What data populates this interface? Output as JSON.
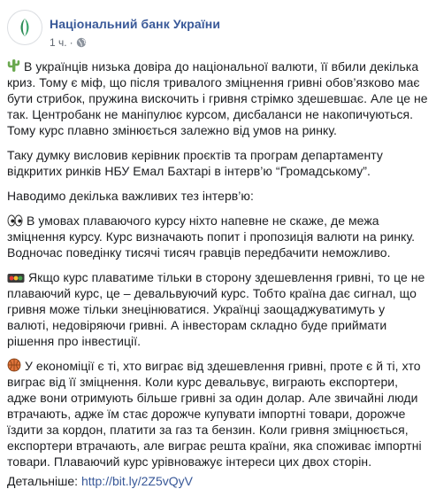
{
  "header": {
    "page_name": "Національний банк України",
    "time": "1 ч.",
    "separator": "·"
  },
  "paragraphs": [
    "В українців низька довіра до національної валюти, її вбили декілька криз. Тому є міф, що після тривалого зміцнення гривні обов’язково має бути стрибок, пружина вискочить і гривня стрімко здешевшає. Але це не так. Центробанк не маніпулює курсом, дисбаланси не накопичуються. Тому курс плавно змінюється залежно від умов на ринку.",
    "Таку думку висловив керівник проєктів та програм департаменту відкритих ринків НБУ Емал Бахтарі в інтерв’ю “Громадському”.",
    "Наводимо декілька важливих тез інтерв’ю:",
    "В умовах плаваючого курсу ніхто напевне не скаже, де межа зміцнення курсу. Курс визначають попит і пропозиція валюти на ринку. Водночас поведінку тисячі тисяч гравців передбачити неможливо.",
    "Якщо курс плаватиме тільки в сторону здешевлення гривні, то це не плаваючий курс, це – девальвуючий курс. Тобто країна дає сигнал, що гривня може тільки знецінюватися. Українці заощаджуватимуть у валюті, недовіряючи гривні. А інвесторам складно буде приймати рішення про інвестиції.",
    "У економіції є ті, хто виграє від здешевлення гривні, проте є й ті, хто виграє від її зміцнення. Коли курс девальвує, виграють експортери, адже вони отримують більше гривні за один долар. Але звичайні люди втрачають, адже їм стає дорожче купувати імпортні товари, дорожче їздити за кордон, платити за газ та бензин. Коли гривня зміцнюється, експортери втрачають, але виграє решта країни, яка споживає імпортні товари. Плаваючий курс урівноважує інтереси цих двох сторін."
  ],
  "tail": {
    "label": "Детальніше:",
    "link": "http://bit.ly/2Z5vQyV"
  },
  "icons": {
    "avatar": "nbu-logo-icon",
    "globe": "globe-icon",
    "p1": "cactus-icon",
    "p4": "eyes-icon",
    "p5": "traffic-light-icon",
    "p6": "basketball-icon"
  },
  "colors": {
    "link": "#385898",
    "text": "#1c1e21",
    "meta": "#606770",
    "logo": "#2e8b57"
  }
}
